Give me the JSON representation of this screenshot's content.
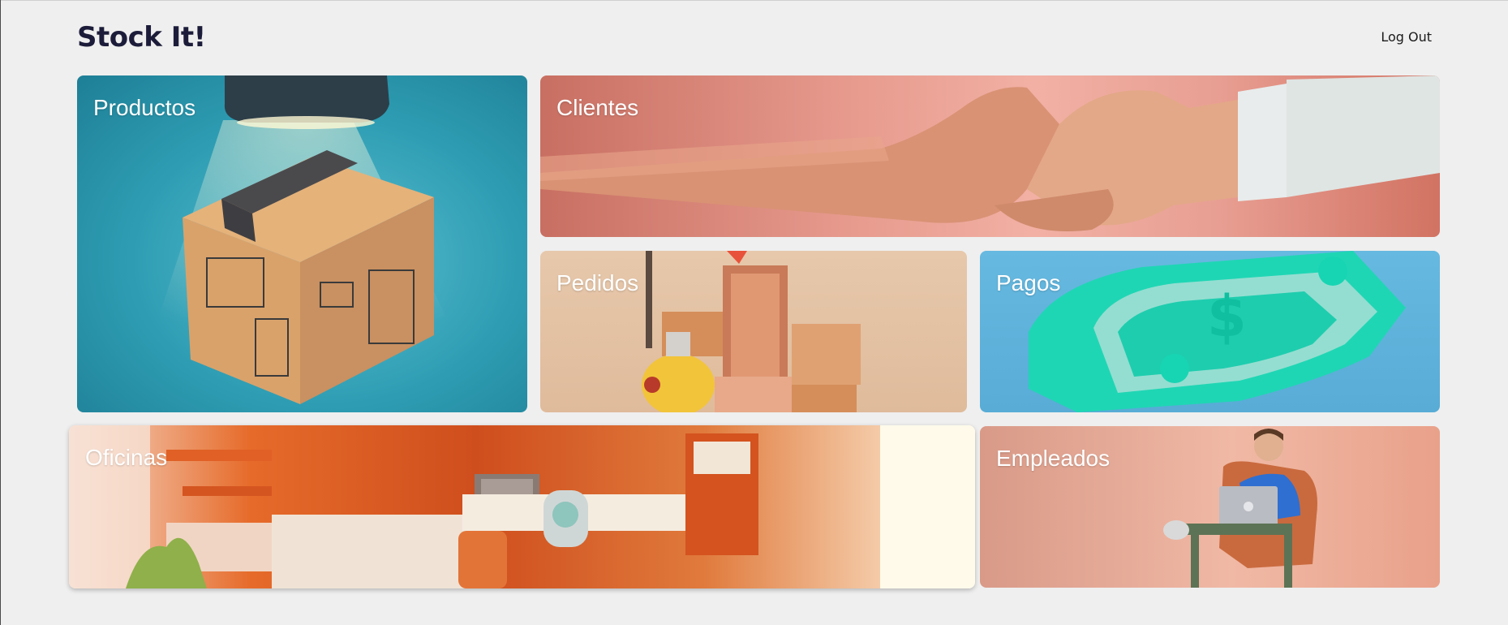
{
  "header": {
    "brand": "Stock It!",
    "logout_label": "Log Out"
  },
  "cards": {
    "productos": "Productos",
    "clientes": "Clientes",
    "pedidos": "Pedidos",
    "pagos": "Pagos",
    "oficinas": "Oficinas",
    "empleados": "Empleados"
  },
  "colors": {
    "background": "#efefef",
    "brand_text": "#1c1c3a",
    "card_text": "#ffffff"
  }
}
